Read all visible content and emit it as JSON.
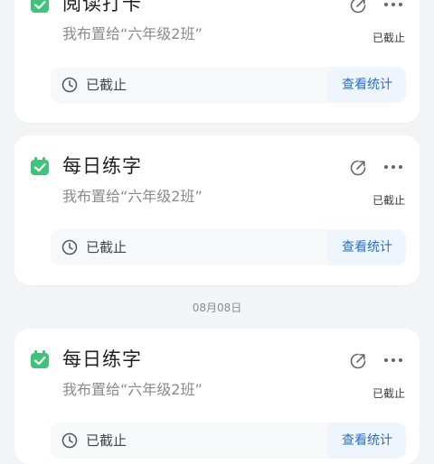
{
  "colors": {
    "page_bg": "#f3f4f6",
    "card_bg": "#ffffff",
    "accent_green": "#3ec37a",
    "stats_text": "#2f6fbf",
    "stats_bg": "#eef5fd"
  },
  "icons": {
    "task": "calendar-check-icon",
    "share": "share-icon",
    "more": "more-dots-icon",
    "status": "clock-icon"
  },
  "tasks": [
    {
      "title": "阅读打卡",
      "subtitle": "我布置给“六年级2班”",
      "badge": "已截止",
      "status": "已截止",
      "action": "查看统计"
    },
    {
      "title": "每日练字",
      "subtitle": "我布置给“六年级2班”",
      "badge": "已截止",
      "status": "已截止",
      "action": "查看统计"
    },
    {
      "title": "每日练字",
      "subtitle": "我布置给“六年级2班”",
      "badge": "已截止",
      "status": "已截止",
      "action": "查看统计"
    }
  ],
  "date_separator": "08月08日"
}
